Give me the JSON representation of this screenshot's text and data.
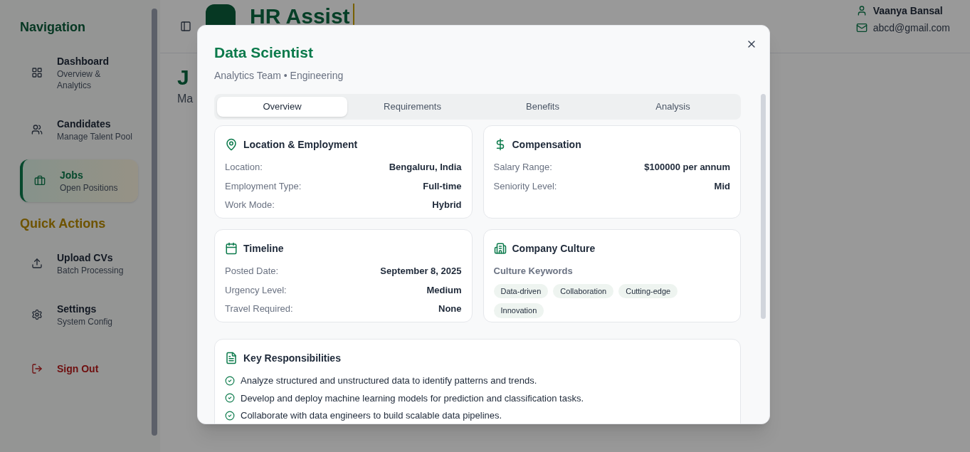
{
  "sidebar": {
    "sections": [
      {
        "title": "Navigation",
        "kind": "nav",
        "items": [
          {
            "label": "Dashboard",
            "sublabel": "Overview & Analytics",
            "selected": false
          },
          {
            "label": "Candidates",
            "sublabel": "Manage Talent Pool",
            "selected": false
          },
          {
            "label": "Jobs",
            "sublabel": "Open Positions",
            "selected": true
          }
        ]
      },
      {
        "title": "Quick Actions",
        "kind": "actions",
        "items": [
          {
            "label": "Upload CVs",
            "sublabel": "Batch Processing",
            "selected": false
          },
          {
            "label": "Settings",
            "sublabel": "System Config",
            "selected": false
          }
        ]
      }
    ],
    "sign_out": "Sign Out"
  },
  "header": {
    "app_name": "HR Assist",
    "user": {
      "name": "Vaanya Bansal",
      "email": "abcd@gmail.com"
    }
  },
  "page": {
    "title": "J",
    "subtitle": "Ma"
  },
  "dialog": {
    "title": "Data Scientist",
    "subtitle": "Analytics Team • Engineering",
    "tabs": [
      {
        "label": "Overview",
        "selected": true
      },
      {
        "label": "Requirements",
        "selected": false
      },
      {
        "label": "Benefits",
        "selected": false
      },
      {
        "label": "Analysis",
        "selected": false
      }
    ],
    "cards": [
      {
        "title": "Location & Employment",
        "kind": "fields",
        "fields": [
          {
            "label": "Location:",
            "value": "Bengaluru, India"
          },
          {
            "label": "Employment Type:",
            "value": "Full-time"
          },
          {
            "label": "Work Mode:",
            "value": "Hybrid"
          }
        ]
      },
      {
        "title": "Compensation",
        "kind": "fields",
        "fields": [
          {
            "label": "Salary Range:",
            "value": "$100000 per annum"
          },
          {
            "label": "Seniority Level:",
            "value": "Mid"
          }
        ]
      },
      {
        "title": "Timeline",
        "kind": "fields",
        "fields": [
          {
            "label": "Posted Date:",
            "value": "September 8, 2025"
          },
          {
            "label": "Urgency Level:",
            "value": "Medium"
          },
          {
            "label": "Travel Required:",
            "value": "None"
          }
        ]
      },
      {
        "title": "Company Culture",
        "kind": "tags",
        "subtitle": "Culture Keywords",
        "tags": [
          "Data-driven",
          "Collaboration",
          "Cutting-edge",
          "Innovation"
        ]
      }
    ],
    "responsibilities": {
      "title": "Key Responsibilities",
      "items": [
        "Analyze structured and unstructured data to identify patterns and trends.",
        "Develop and deploy machine learning models for prediction and classification tasks.",
        "Collaborate with data engineers to build scalable data pipelines."
      ]
    }
  }
}
